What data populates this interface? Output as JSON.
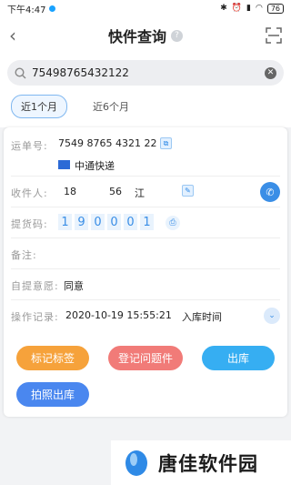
{
  "status": {
    "time": "下午4:47",
    "battery": "76"
  },
  "header": {
    "title": "快件查询",
    "help_icon": "?"
  },
  "search": {
    "value": "75498765432122"
  },
  "tabs": [
    {
      "label": "近1个月",
      "active": true
    },
    {
      "label": "近6个月",
      "active": false
    }
  ],
  "detail": {
    "waybill_label": "运单号:",
    "waybill_no": "7549 8765 4321 22",
    "courier": "中通快递",
    "recipient_label": "收件人:",
    "recipient_phone": "18",
    "recipient_phone_tail": "56",
    "recipient_name": "江",
    "pickup_label": "提货码:",
    "pickup_code": [
      "1",
      "9",
      "0",
      "0",
      "0",
      "1"
    ],
    "note_label": "备注:",
    "self_pickup_label": "自提意愿:",
    "self_pickup_value": "同意",
    "log_label": "操作记录:",
    "log_time": "2020-10-19 15:55:21",
    "log_action": "入库时间"
  },
  "actions": {
    "mark_label": "标记标签",
    "problem_label": "登记问题件",
    "out_label": "出库",
    "photo_out_label": "拍照出库"
  },
  "colors": {
    "mark": "#f6a23b",
    "problem": "#f17b78",
    "out": "#36aef2",
    "photo_out": "#4a87ef",
    "accent": "#3a8ee6"
  },
  "watermark": {
    "text": "唐佳软件园"
  }
}
